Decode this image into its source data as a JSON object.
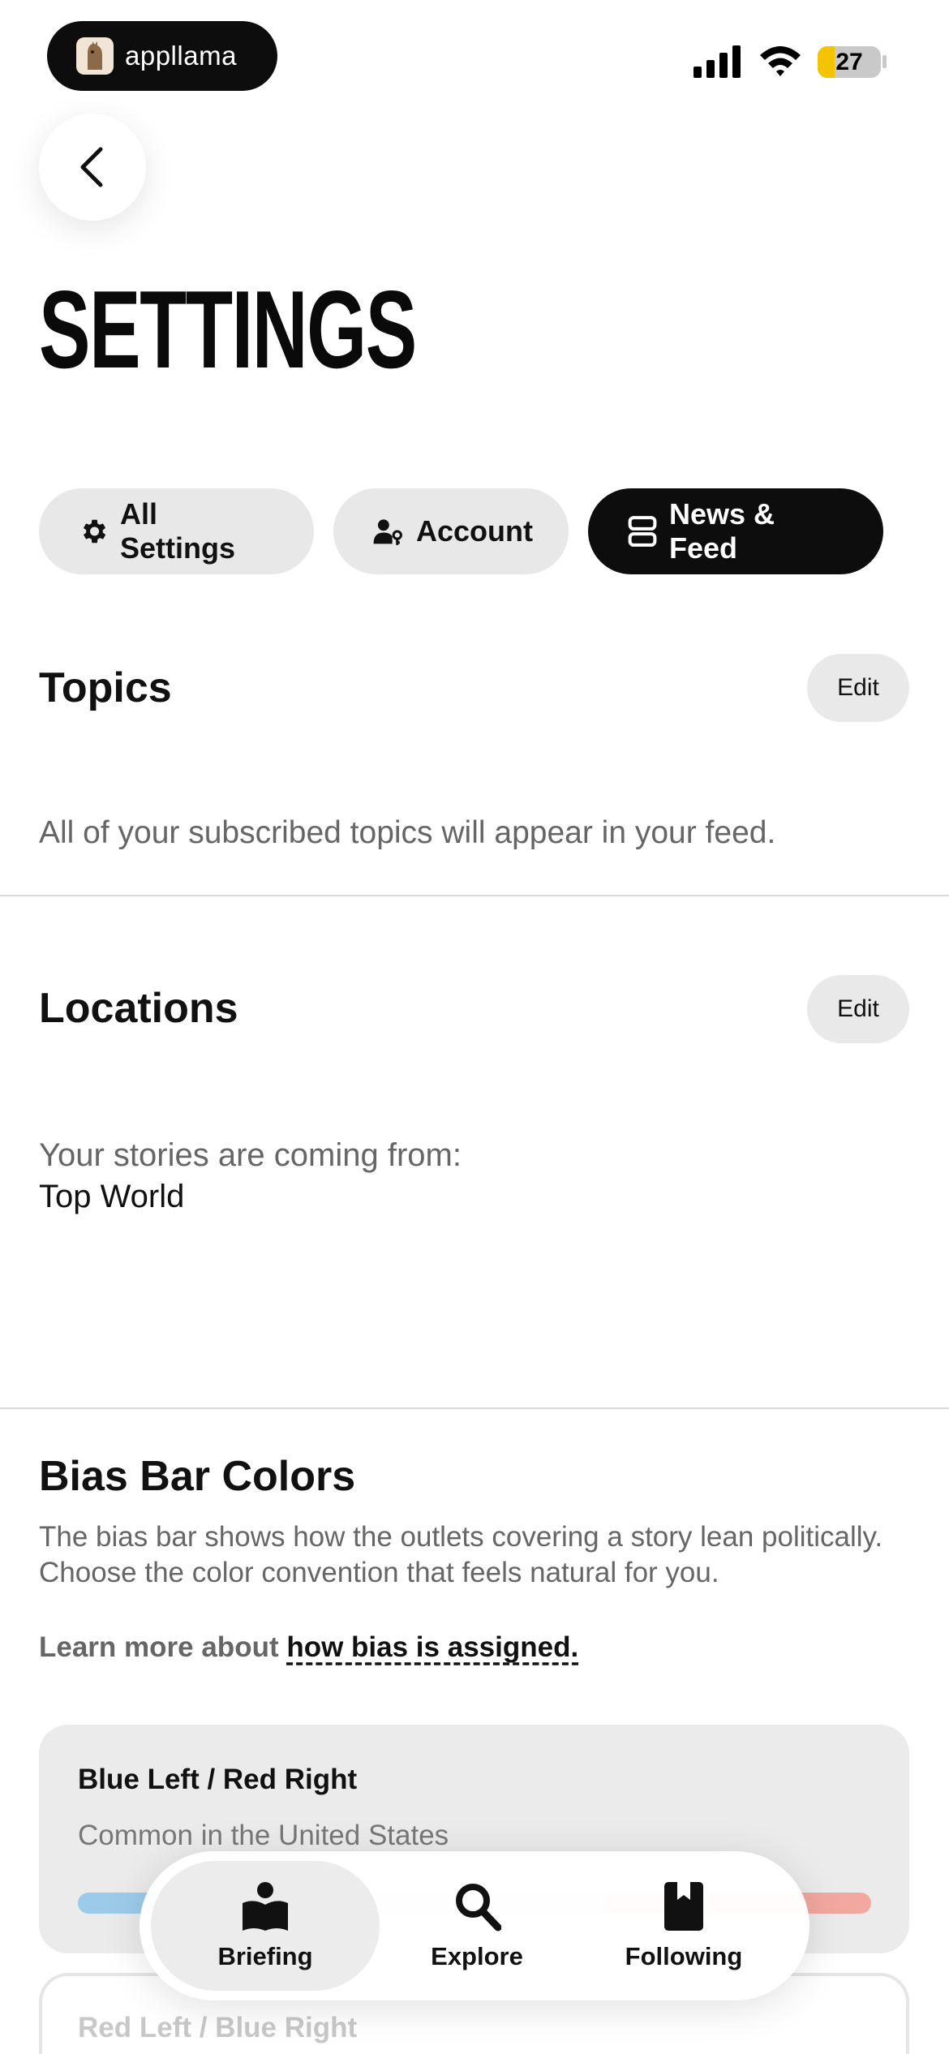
{
  "status_bar": {
    "app_name": "appllama",
    "battery_level": "27",
    "battery_fraction": 0.27
  },
  "page": {
    "title": "SETTINGS"
  },
  "tabs": [
    {
      "label": "All Settings",
      "icon": "gear-icon",
      "active": false
    },
    {
      "label": "Account",
      "icon": "user-key-icon",
      "active": false
    },
    {
      "label": "News & Feed",
      "icon": "feed-icon",
      "active": true
    }
  ],
  "topics": {
    "title": "Topics",
    "edit_label": "Edit",
    "description": "All of your subscribed topics will appear in your feed."
  },
  "locations": {
    "title": "Locations",
    "edit_label": "Edit",
    "label": "Your stories are coming from:",
    "value": "Top World"
  },
  "bias": {
    "title": "Bias Bar Colors",
    "description": "The bias bar shows how the outlets covering a story lean politically. Choose the color convention that feels natural for you.",
    "learn_prefix": "Learn more about",
    "learn_link": "how bias is assigned.",
    "options": [
      {
        "name": "Blue Left / Red Right",
        "subtitle": "Common in the United States",
        "left_color": "#9ccbe9",
        "center_color": "#e6e6e6",
        "right_color": "#f1a89f"
      },
      {
        "name": "Red Left / Blue Right"
      }
    ]
  },
  "bottom_nav": [
    {
      "label": "Briefing",
      "icon": "briefing-book-icon",
      "active": true
    },
    {
      "label": "Explore",
      "icon": "search-icon",
      "active": false
    },
    {
      "label": "Following",
      "icon": "bookmark-icon",
      "active": false
    }
  ]
}
